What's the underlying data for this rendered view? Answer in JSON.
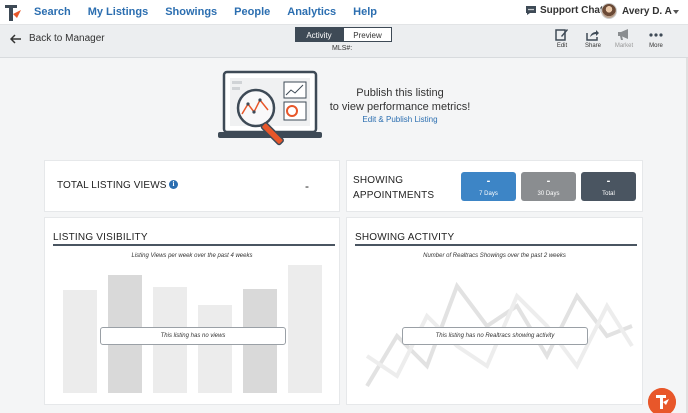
{
  "nav": {
    "links": [
      "Search",
      "My Listings",
      "Showings",
      "People",
      "Analytics",
      "Help"
    ],
    "support_label": "Support Chat",
    "user_name": "Avery D. A"
  },
  "subheader": {
    "back_label": "Back to Manager",
    "tabs": [
      "Activity",
      "Preview"
    ],
    "mls_label": "MLS#:",
    "tools": [
      {
        "label": "Edit",
        "icon": "edit-icon",
        "enabled": true
      },
      {
        "label": "Share",
        "icon": "share-icon",
        "enabled": true
      },
      {
        "label": "Market",
        "icon": "megaphone-icon",
        "enabled": false
      },
      {
        "label": "More",
        "icon": "more-dots-icon",
        "enabled": true
      }
    ]
  },
  "hero": {
    "line1": "Publish this listing",
    "line2": "to view performance metrics!",
    "link": "Edit & Publish Listing"
  },
  "views_card": {
    "title": "TOTAL LISTING VIEWS",
    "value": "-"
  },
  "appointments_card": {
    "title_line1": "SHOWING",
    "title_line2": "APPOINTMENTS",
    "stats": [
      {
        "value": "-",
        "label": "7 Days",
        "color": "#3d85c6"
      },
      {
        "value": "-",
        "label": "30 Days",
        "color": "#8a8d90"
      },
      {
        "value": "-",
        "label": "Total",
        "color": "#4a5561"
      }
    ]
  },
  "visibility": {
    "title": "LISTING VISIBILITY",
    "subtitle": "Listing Views per week over the past 4 weeks",
    "empty": "This listing has no views"
  },
  "activity": {
    "title": "SHOWING ACTIVITY",
    "subtitle": "Number of Realtracs Showings over the past 2 weeks",
    "empty": "This listing has no Realtracs showing activity"
  },
  "colors": {
    "brand_blue": "#2b6eb0",
    "brand_orange": "#e8572a",
    "dark_slate": "#3e4a56"
  }
}
